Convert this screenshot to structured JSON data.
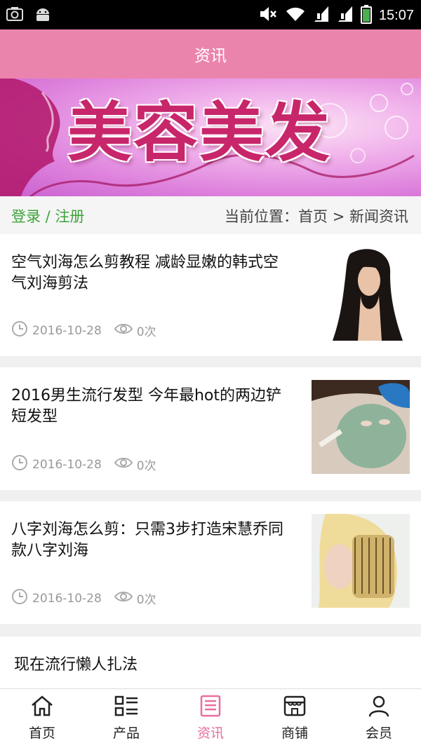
{
  "statusbar": {
    "time": "15:07"
  },
  "header": {
    "title": "资讯"
  },
  "banner": {
    "title": "美容美发"
  },
  "crumbbar": {
    "login": "登录 / 注册",
    "location": "当前位置：首页 > 新闻资讯"
  },
  "news": [
    {
      "title": "空气刘海怎么剪教程 减龄显嫩的韩式空气刘海剪法",
      "date": "2016-10-28",
      "views": "0次"
    },
    {
      "title": "2016男生流行发型 今年最hot的两边铲短发型",
      "date": "2016-10-28",
      "views": "0次"
    },
    {
      "title": "八字刘海怎么剪：只需3步打造宋慧乔同款八字刘海",
      "date": "2016-10-28",
      "views": "0次"
    },
    {
      "title": "现在流行懒人扎法"
    }
  ],
  "nav": [
    {
      "label": "首页",
      "icon": "home-icon"
    },
    {
      "label": "产品",
      "icon": "grid-list-icon"
    },
    {
      "label": "资讯",
      "icon": "news-icon",
      "active": true
    },
    {
      "label": "商铺",
      "icon": "store-icon"
    },
    {
      "label": "会员",
      "icon": "user-icon"
    }
  ],
  "colors": {
    "accent": "#eb84ad",
    "login_green": "#3da33a",
    "nav_active": "#e96ea0"
  }
}
